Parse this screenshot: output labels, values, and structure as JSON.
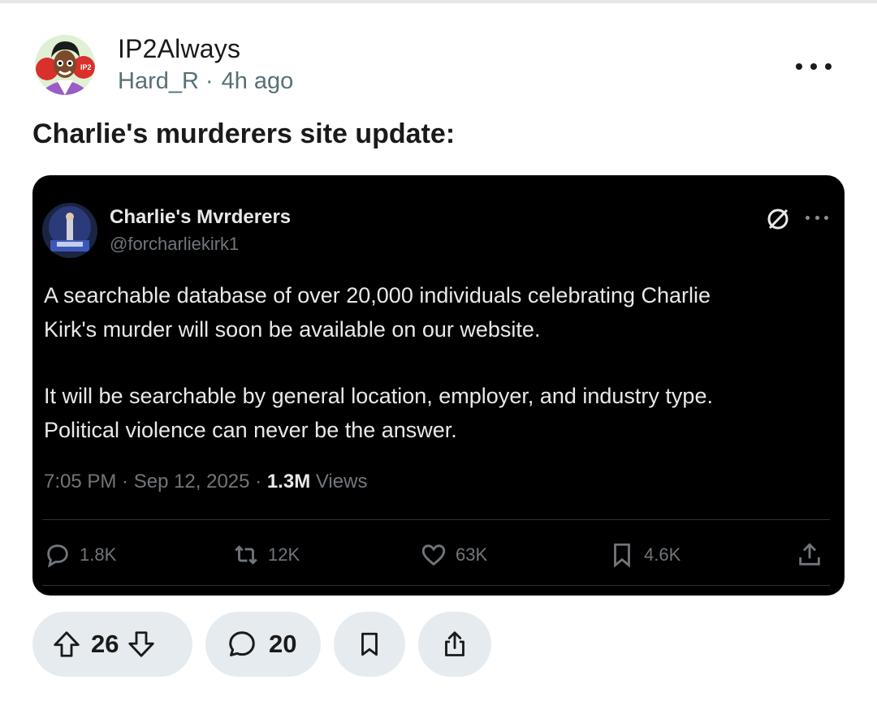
{
  "post": {
    "author": "IP2Always",
    "username": "Hard_R",
    "separator": "·",
    "time": "4h ago",
    "title": "Charlie's murderers site update:"
  },
  "icons": {
    "avatar": "avatar-image",
    "more": "more-horizontal-icon",
    "upvote": "upvote-arrow-icon",
    "downvote": "downvote-arrow-icon",
    "comment": "comment-bubble-icon",
    "save": "bookmark-icon",
    "share": "share-icon"
  },
  "embedded_tweet": {
    "name": "Charlie's Mvrderers",
    "handle": "@forcharliekirk1",
    "paragraphs": [
      "A searchable database of over 20,000 individuals celebrating Charlie\nKirk's murder will soon be available on our website.",
      "It will be searchable by general location, employer, and industry type.\nPolitical violence can never be the answer."
    ],
    "timestamp": "7:05 PM · Sep 12, 2025 · ",
    "views_count": "1.3M",
    "views_label": " Views",
    "stats": {
      "replies": "1.8K",
      "reposts": "12K",
      "likes": "63K",
      "bookmarks": "4.6K"
    }
  },
  "actions": {
    "vote_count": "26",
    "comment_count": "20"
  },
  "colors": {
    "pill_bg": "#e5ebee",
    "meta_text": "#576f76",
    "tweet_bg": "#000000",
    "tweet_secondary": "#71767b"
  }
}
